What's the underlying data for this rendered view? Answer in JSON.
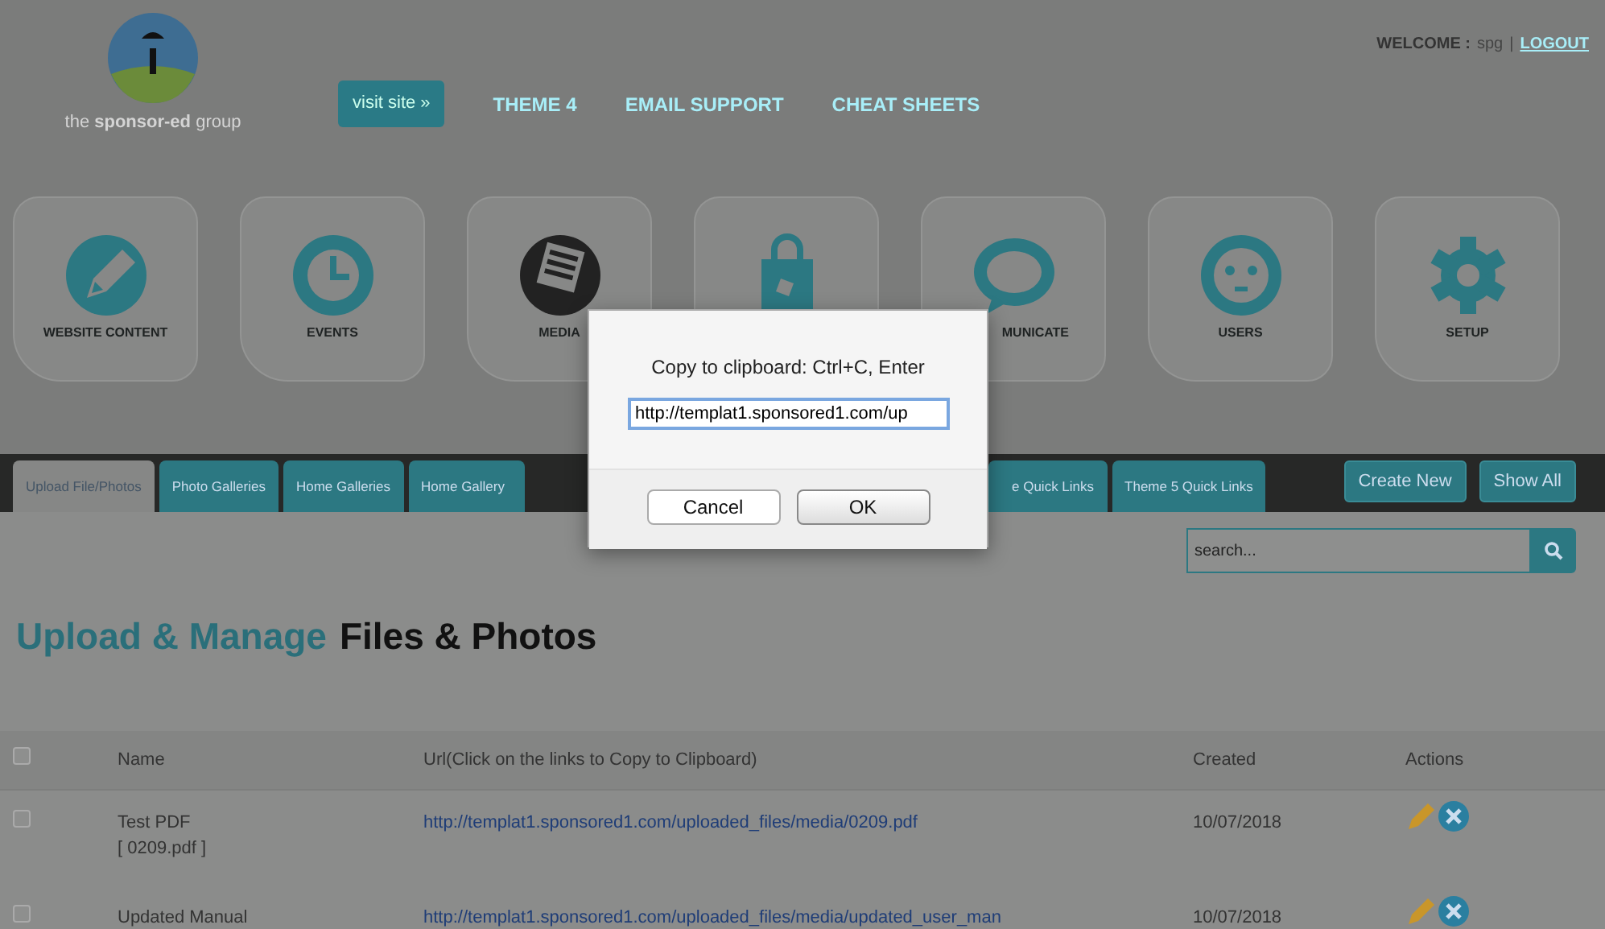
{
  "header": {
    "logo_text": "the **sponsor-ed** group",
    "welcome_label": "WELCOME :",
    "user": "spg",
    "separator": "|",
    "logout": "LOGOUT"
  },
  "nav": [
    {
      "label": "visit site »",
      "kind": "button"
    },
    {
      "label": "THEME 4",
      "kind": "link"
    },
    {
      "label": "EMAIL SUPPORT",
      "kind": "link"
    },
    {
      "label": "CHEAT SHEETS",
      "kind": "link"
    }
  ],
  "tiles": [
    {
      "label": "WEBSITE CONTENT",
      "kind": "normal"
    },
    {
      "label": "EVENTS",
      "kind": "normal"
    },
    {
      "label": "MEDIA",
      "kind": "normal"
    },
    {
      "kind": "unlabeled"
    },
    {
      "label": "MUNICATE",
      "kind": "covered-left"
    },
    {
      "label": "USERS",
      "kind": "normal"
    },
    {
      "label": "SETUP",
      "kind": "normal"
    }
  ],
  "tabs": [
    {
      "label": "Upload File/Photos",
      "selected": true,
      "kind": "normal"
    },
    {
      "label": "Photo Galleries",
      "selected": false,
      "kind": "normal"
    },
    {
      "label": "Home Galleries",
      "selected": false,
      "kind": "normal"
    },
    {
      "label": "Home Gallery",
      "selected": false,
      "kind": "covered-right"
    },
    {
      "label": "e Quick Links",
      "selected": false,
      "kind": "covered-left"
    },
    {
      "label": "Theme 5 Quick Links",
      "selected": false,
      "kind": "normal"
    }
  ],
  "actions": [
    "Create New",
    "Show All"
  ],
  "search": {
    "placeholder": "search..."
  },
  "title": {
    "accent": "Upload & Manage",
    "rest": "Files & Photos"
  },
  "table": {
    "select_all": {
      "checked": false
    },
    "columns": [
      "Name",
      "Url(Click on the links to Copy to Clipboard)",
      "Created",
      "Actions"
    ],
    "rows": [
      {
        "checked": false,
        "name": "Test PDF",
        "file": "[ 0209.pdf ]",
        "url": "http://templat1.sponsored1.com/uploaded_files/media/0209.pdf",
        "created": "10/07/2018"
      },
      {
        "checked": false,
        "name": "Updated Manual",
        "url": "http://templat1.sponsored1.com/uploaded_files/media/updated_user_man",
        "created": "10/07/2018"
      }
    ]
  },
  "dialog": {
    "message": "Copy to clipboard: Ctrl+C, Enter",
    "value": "http://templat1.sponsored1.com/up",
    "buttons": [
      {
        "label": "Cancel",
        "selected": false
      },
      {
        "label": "OK",
        "selected": true
      }
    ]
  }
}
